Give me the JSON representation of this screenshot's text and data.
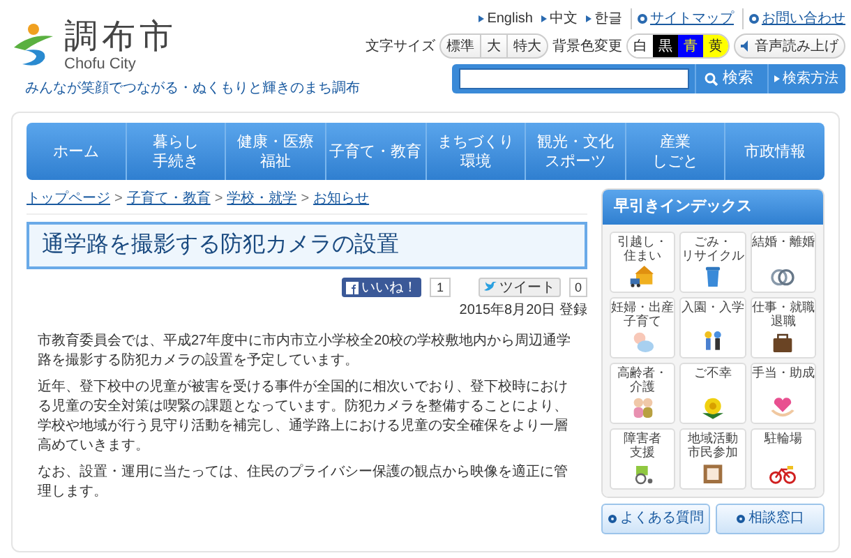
{
  "header": {
    "logo_name": "調布市",
    "logo_sub": "Chofu City",
    "tagline": "みんなが笑顔でつながる・ぬくもりと輝きのまち調布",
    "languages": [
      "English",
      "中文",
      "한글"
    ],
    "links": [
      "サイトマップ",
      "お問い合わせ"
    ],
    "font_size": {
      "label": "文字サイズ",
      "options": [
        "標準",
        "大",
        "特大"
      ]
    },
    "bg_color": {
      "label": "背景色変更",
      "options": [
        {
          "label": "白",
          "color": "#ffffff"
        },
        {
          "label": "黒",
          "color": "#000000"
        },
        {
          "label": "青",
          "color": "#0000ff"
        },
        {
          "label": "黄",
          "color": "#ffff00"
        }
      ]
    },
    "voice": "音声読み上げ",
    "search": {
      "button": "検索",
      "method": "検索方法"
    }
  },
  "nav": [
    {
      "lines": [
        "ホーム"
      ]
    },
    {
      "lines": [
        "暮らし",
        "手続き"
      ]
    },
    {
      "lines": [
        "健康・医療",
        "福祉"
      ]
    },
    {
      "lines": [
        "子育て・教育"
      ]
    },
    {
      "lines": [
        "まちづくり",
        "環境"
      ]
    },
    {
      "lines": [
        "観光・文化",
        "スポーツ"
      ]
    },
    {
      "lines": [
        "産業",
        "しごと"
      ]
    },
    {
      "lines": [
        "市政情報"
      ]
    }
  ],
  "breadcrumb": {
    "separator": ">",
    "items": [
      "トップページ",
      "子育て・教育",
      "学校・就学",
      "お知らせ"
    ]
  },
  "title": "通学路を撮影する防犯カメラの設置",
  "social": {
    "like": {
      "label": "いいね！",
      "count": "1"
    },
    "tweet": {
      "label": "ツイート",
      "count": "0"
    }
  },
  "date": "2015年8月20日 登録",
  "paragraphs": [
    "市教育委員会では、平成27年度中に市内市立小学校全20校の学校敷地内から周辺通学路を撮影する防犯カメラの設置を予定しています。",
    "近年、登下校中の児童が被害を受ける事件が全国的に相次いでおり、登下校時における児童の安全対策は喫緊の課題となっています。防犯カメラを整備することにより、学校や地域が行う見守り活動を補完し、通学路上における児童の安全確保をより一層高めていきます。",
    "なお、設置・運用に当たっては、住民のプライバシー保護の観点から映像を適正に管理します。"
  ],
  "sidebar": {
    "title": "早引きインデックス",
    "tiles": [
      {
        "lines": [
          "引越し・",
          "住まい"
        ]
      },
      {
        "lines": [
          "ごみ・",
          "リサイクル"
        ]
      },
      {
        "lines": [
          "結婚・離婚"
        ]
      },
      {
        "lines": [
          "妊婦・出産",
          "子育て"
        ]
      },
      {
        "lines": [
          "入園・入学"
        ]
      },
      {
        "lines": [
          "仕事・就職",
          "退職"
        ]
      },
      {
        "lines": [
          "高齢者・",
          "介護"
        ]
      },
      {
        "lines": [
          "ご不幸"
        ]
      },
      {
        "lines": [
          "手当・助成"
        ]
      },
      {
        "lines": [
          "障害者",
          "支援"
        ]
      },
      {
        "lines": [
          "地域活動",
          "市民参加"
        ]
      },
      {
        "lines": [
          "駐輪場"
        ]
      }
    ],
    "buttons": [
      "よくある質問",
      "相談窓口"
    ]
  }
}
